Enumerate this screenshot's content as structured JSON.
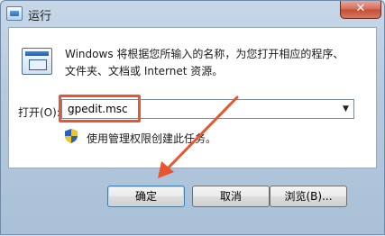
{
  "window": {
    "title": "运行",
    "close_label": "✕"
  },
  "description": {
    "line1": "Windows 将根据您所输入的名称，为您打开相应的程序、",
    "line2": "文件夹、文档或 Internet 资源。"
  },
  "open_field": {
    "label": "打开(O):",
    "value": "gpedit.msc"
  },
  "admin_note": "使用管理权限创建此任务。",
  "buttons": {
    "ok": "确定",
    "cancel": "取消",
    "browse": "浏览(B)..."
  },
  "colors": {
    "highlight": "#e8552e",
    "arrow": "#e8552e"
  }
}
